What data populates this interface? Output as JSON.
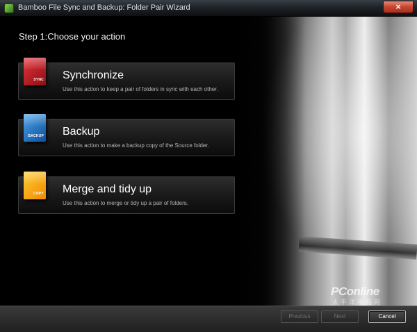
{
  "window": {
    "title": "Bamboo File Sync and Backup: Folder Pair Wizard",
    "close_label": "×"
  },
  "wizard": {
    "step_heading": "Step 1:Choose your action",
    "actions": [
      {
        "title": "Synchronize",
        "description": "Use this action to keep a pair of folders in sync with each other.",
        "icon_label": "SYNC",
        "icon": "sync-folder-icon",
        "color": "#d0252b"
      },
      {
        "title": "Backup",
        "description": "Use this action to make a backup copy of the Source folder.",
        "icon_label": "BACKUP",
        "icon": "backup-folder-icon",
        "color": "#2a78c8"
      },
      {
        "title": "Merge and tidy up",
        "description": "Use this action to merge or tidy up a pair of folders.",
        "icon_label": "COPY",
        "icon": "copy-folder-icon",
        "color": "#f5a400"
      }
    ]
  },
  "watermark": {
    "text": "PConline",
    "subtext": "太平洋电脑网"
  },
  "footer": {
    "previous_label": "Previous",
    "next_label": "Next",
    "cancel_label": "Cancel"
  }
}
